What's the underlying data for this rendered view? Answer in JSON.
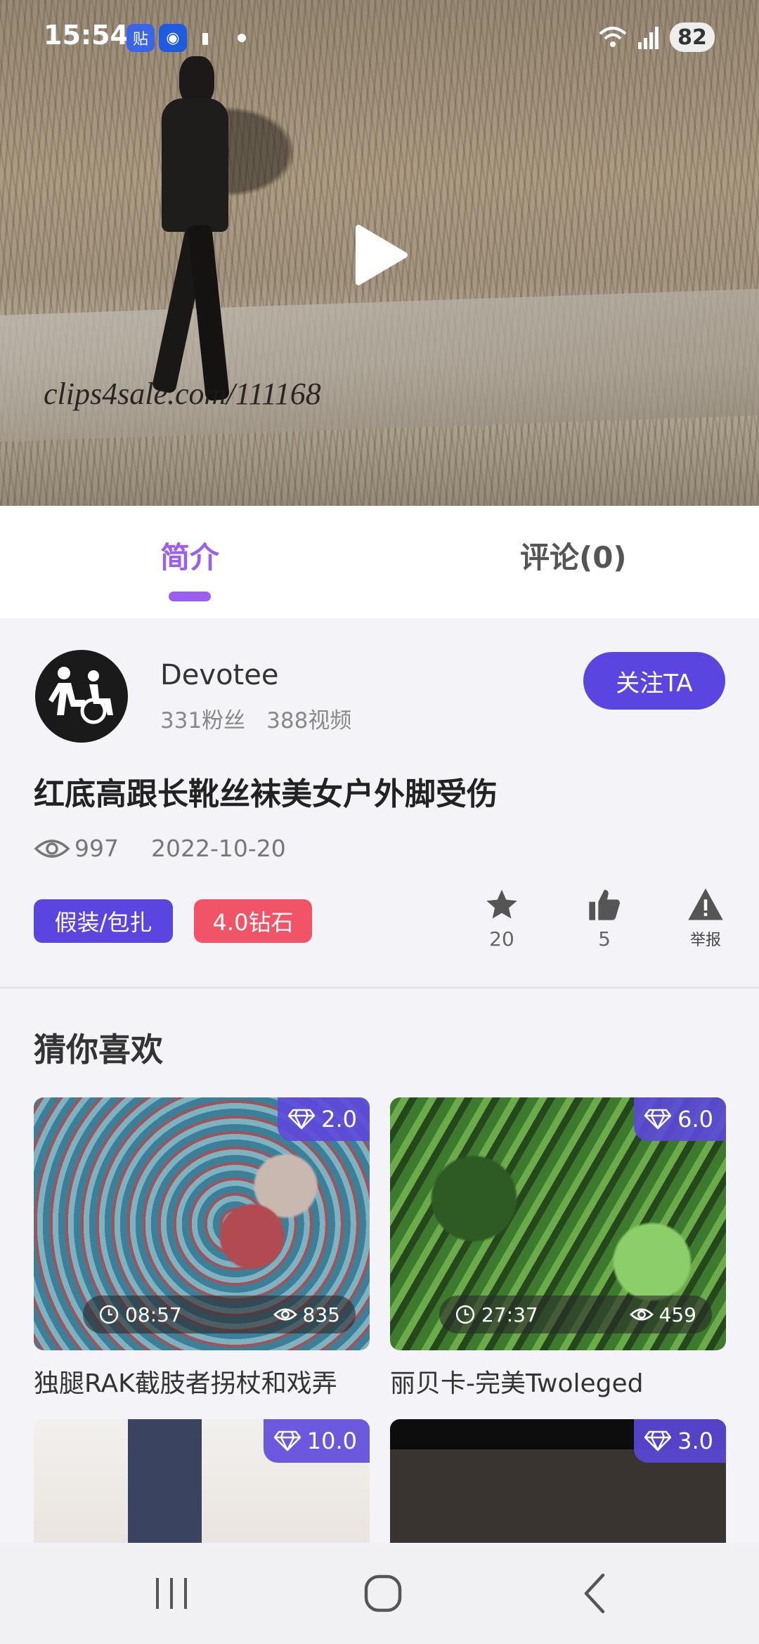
{
  "status_bar": {
    "time": "15:54",
    "battery": "82",
    "app_icons": [
      "贴",
      "◉",
      "▮"
    ]
  },
  "video": {
    "watermark": "clips4sale.com/111168"
  },
  "tabs": {
    "intro": "简介",
    "comments": "评论(0)"
  },
  "author": {
    "name": "Devotee",
    "fans": "331粉丝",
    "videos": "388视频",
    "follow_label": "关注TA"
  },
  "detail": {
    "title": "红底高跟长靴丝袜美女户外脚受伤",
    "views": "997",
    "date": "2022-10-20",
    "category_tag": "假装/包扎",
    "price_tag": "4.0钻石",
    "favorites": "20",
    "likes": "5",
    "report_label": "举报"
  },
  "recommendations": {
    "title": "猜你喜欢",
    "items": [
      {
        "price": "2.0",
        "duration": "08:57",
        "views": "835",
        "caption": "独腿RAK截肢者拐杖和戏弄"
      },
      {
        "price": "6.0",
        "duration": "27:37",
        "views": "459",
        "caption": "丽贝卡-完美Twoleged"
      },
      {
        "price": "10.0"
      },
      {
        "price": "3.0"
      }
    ]
  },
  "colors": {
    "accent_purple": "#9b5ff0",
    "button_indigo": "#5b45e0",
    "price_red": "#f05466"
  }
}
